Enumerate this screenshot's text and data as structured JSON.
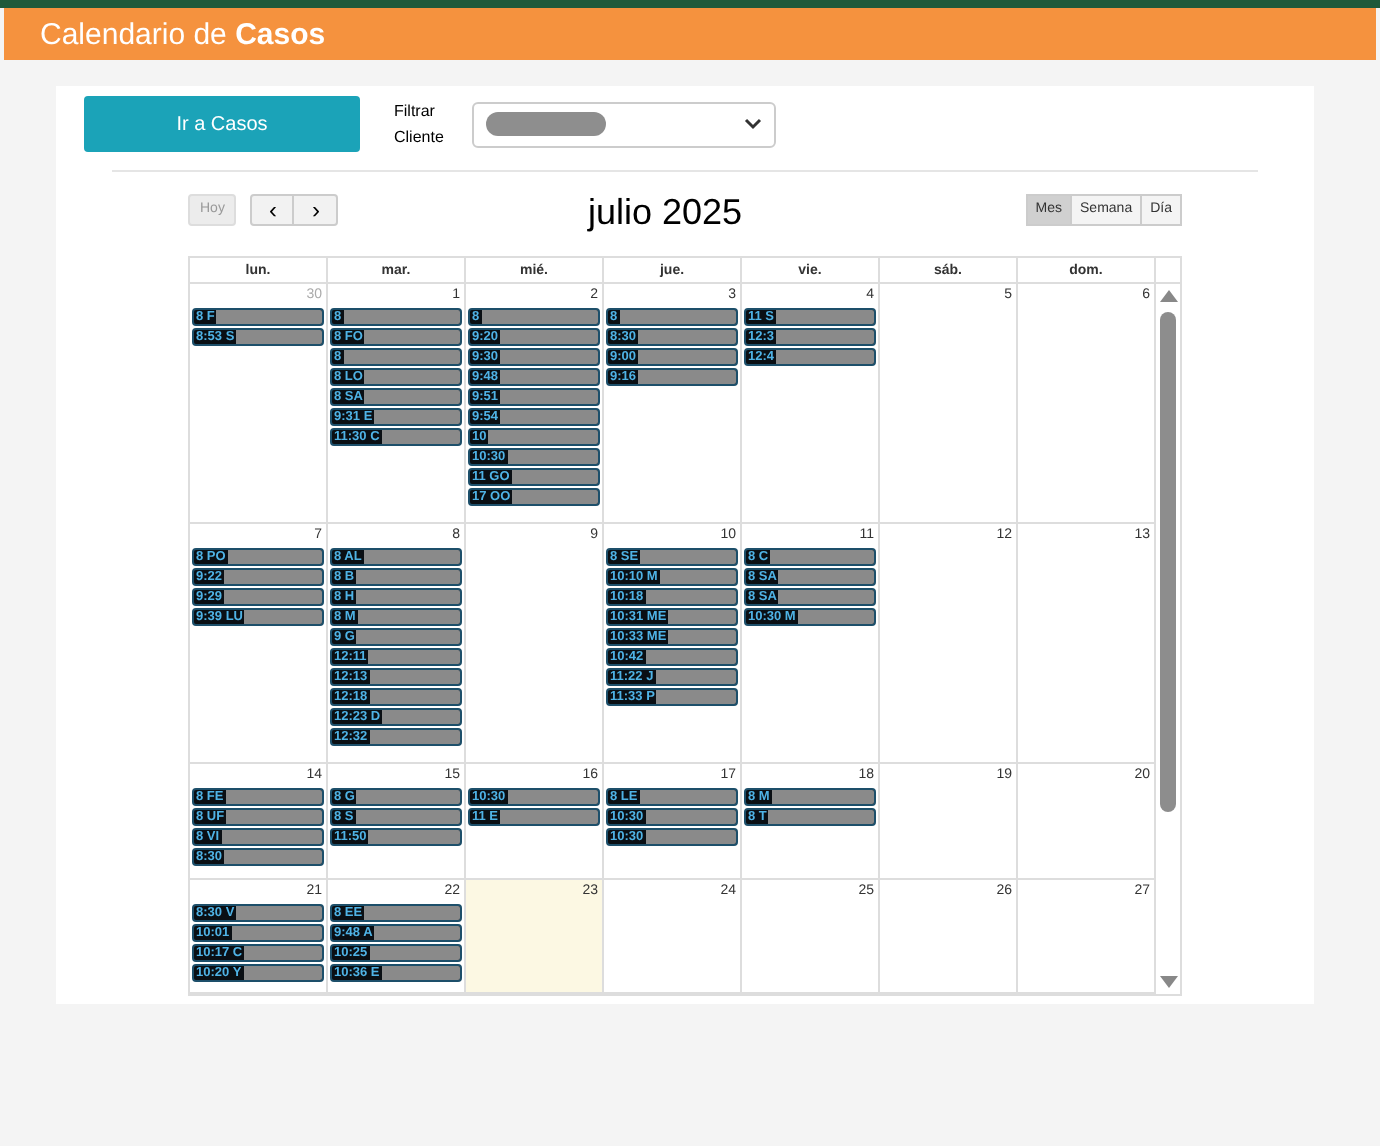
{
  "header": {
    "title": "Calendario de **Casos**"
  },
  "toolbar": {
    "go_button": "Ir a Casos",
    "filter_label": "Filtrar Cliente",
    "client_select": {
      "value_redacted": true
    }
  },
  "calendar": {
    "today_button": {
      "label": "Hoy",
      "disabled": true
    },
    "prev": "‹",
    "next": "›",
    "title": "julio 2025",
    "views": [
      {
        "label": "Mes",
        "selected": true
      },
      {
        "label": "Semana",
        "selected": false
      },
      {
        "label": "Día",
        "selected": false
      }
    ],
    "day_headers": [
      "lun.",
      "mar.",
      "mié.",
      "jue.",
      "vie.",
      "sáb.",
      "dom."
    ],
    "weeks": [
      {
        "days": [
          {
            "number": "30",
            "other_month": true,
            "today": false,
            "events": [
              "8 F",
              "8:53 S"
            ]
          },
          {
            "number": "1",
            "other_month": false,
            "today": false,
            "events": [
              "8",
              "8 FO",
              "8",
              "8 LO",
              "8 SA",
              "9:31 E",
              "11:30 C"
            ]
          },
          {
            "number": "2",
            "other_month": false,
            "today": false,
            "events": [
              "8",
              "9:20",
              "9:30",
              "9:48",
              "9:51",
              "9:54",
              "10",
              "10:30",
              "11 GO",
              "17 OO"
            ]
          },
          {
            "number": "3",
            "other_month": false,
            "today": false,
            "events": [
              "8",
              "8:30",
              "9:00",
              "9:16"
            ]
          },
          {
            "number": "4",
            "other_month": false,
            "today": false,
            "events": [
              "11 S",
              "12:3",
              "12:4"
            ]
          },
          {
            "number": "5",
            "other_month": false,
            "today": false
          },
          {
            "number": "6",
            "other_month": false,
            "today": false
          }
        ]
      },
      {
        "days": [
          {
            "number": "7",
            "other_month": false,
            "today": false,
            "events": [
              "8 PO",
              "9:22",
              "9:29",
              "9:39 LU"
            ]
          },
          {
            "number": "8",
            "other_month": false,
            "today": false,
            "events": [
              "8 AL",
              "8 B",
              "8 H",
              "8 M",
              "9 G",
              "12:11",
              "12:13",
              "12:18",
              "12:23 D",
              "12:32"
            ]
          },
          {
            "number": "9",
            "other_month": false,
            "today": false
          },
          {
            "number": "10",
            "other_month": false,
            "today": false,
            "events": [
              "8 SE",
              "10:10 M",
              "10:18",
              "10:31 ME",
              "10:33 ME",
              "10:42",
              "11:22 J",
              "11:33 P"
            ]
          },
          {
            "number": "11",
            "other_month": false,
            "today": false,
            "events": [
              "8 C",
              "8 SA",
              "8 SA",
              "10:30 M"
            ]
          },
          {
            "number": "12",
            "other_month": false,
            "today": false
          },
          {
            "number": "13",
            "other_month": false,
            "today": false
          }
        ]
      },
      {
        "days": [
          {
            "number": "14",
            "other_month": false,
            "today": false,
            "events": [
              "8 FE",
              "8 UF",
              "8 VI",
              "8:30"
            ]
          },
          {
            "number": "15",
            "other_month": false,
            "today": false,
            "events": [
              "8 G",
              "8 S",
              "11:50"
            ]
          },
          {
            "number": "16",
            "other_month": false,
            "today": false,
            "events": [
              "10:30",
              "11 E"
            ]
          },
          {
            "number": "17",
            "other_month": false,
            "today": false,
            "events": [
              "8 LE",
              "10:30",
              "10:30"
            ]
          },
          {
            "number": "18",
            "other_month": false,
            "today": false,
            "events": [
              "8 M",
              "8 T"
            ]
          },
          {
            "number": "19",
            "other_month": false,
            "today": false
          },
          {
            "number": "20",
            "other_month": false,
            "today": false
          }
        ]
      },
      {
        "days": [
          {
            "number": "21",
            "other_month": false,
            "today": false,
            "events": [
              "8:30 V",
              "10:01",
              "10:17 C",
              "10:20 Y"
            ]
          },
          {
            "number": "22",
            "other_month": false,
            "today": false,
            "events": [
              "8 EE",
              "9:48 A",
              "10:25",
              "10:36 E"
            ]
          },
          {
            "number": "23",
            "other_month": false,
            "today": true
          },
          {
            "number": "24",
            "other_month": false,
            "today": false
          },
          {
            "number": "25",
            "other_month": false,
            "today": false
          },
          {
            "number": "26",
            "other_month": false,
            "today": false
          },
          {
            "number": "27",
            "other_month": false,
            "today": false
          }
        ]
      }
    ]
  }
}
